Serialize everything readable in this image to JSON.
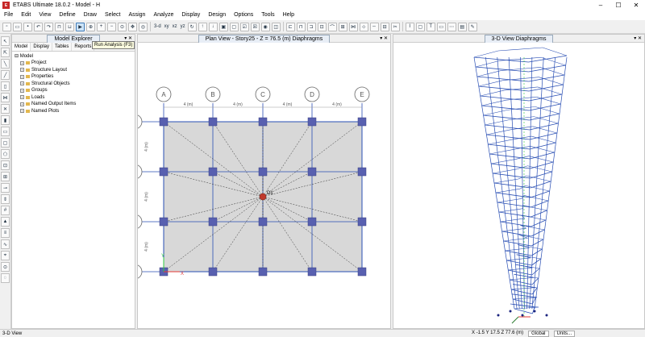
{
  "window": {
    "title": "ETABS Ultimate 18.0.2 - Model - H",
    "app_icon": "E"
  },
  "menu": [
    "File",
    "Edit",
    "View",
    "Define",
    "Draw",
    "Select",
    "Assign",
    "Analyze",
    "Display",
    "Design",
    "Options",
    "Tools",
    "Help"
  ],
  "toolbar": {
    "tools": [
      "new-icon",
      "open-icon",
      "save-icon",
      "undo-icon",
      "redo-icon",
      "lock-icon",
      "unlock-icon",
      "run-analysis-icon",
      "zoom-window-icon",
      "zoom-in-icon",
      "zoom-out-icon",
      "zoom-fit-icon",
      "pan-icon",
      "zoom-previous-icon"
    ],
    "view_3d": "3-d",
    "view_xy": "xy",
    "view_xz": "xz",
    "view_yz": "yz",
    "tooltip": "Run Analysis (F3)"
  },
  "explorer": {
    "title": "Model Explorer",
    "tabs": [
      "Model",
      "Display",
      "Tables",
      "Reports"
    ],
    "root": "Model",
    "items": [
      "Project",
      "Structure Layout",
      "Properties",
      "Structural Objects",
      "Groups",
      "Loads",
      "Named Output Items",
      "Named Plots"
    ]
  },
  "plan": {
    "title": "Plan View - Story25 - Z = 76.5 (m)  Diaphragms",
    "grid_columns": [
      "A",
      "B",
      "C",
      "D",
      "E"
    ],
    "spacing_label": "4 (m)",
    "diaphragm_label": "D1"
  },
  "view3d": {
    "title": "3-D View  Diaphragms"
  },
  "status": {
    "left": "3-D View",
    "coords": "X -1.5  Y 17.5  Z 77.6 (m)",
    "story": "Global",
    "units": "Units..."
  },
  "colors": {
    "grid_line": "#2a4fb4",
    "column": "#5860b0",
    "slab": "#d8d8d8",
    "label_bubble": "#666666"
  }
}
